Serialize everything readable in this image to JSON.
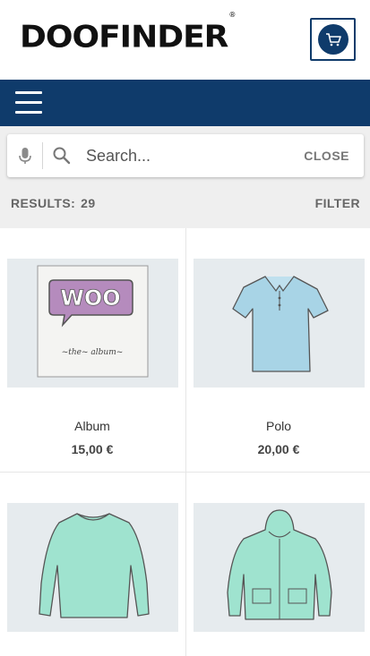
{
  "header": {
    "logo_text": "DOOFINDER",
    "logo_mark": "®",
    "cart_icon": "cart-icon",
    "accent": "#0f3b6b"
  },
  "navbar": {
    "menu_icon": "hamburger-icon"
  },
  "search": {
    "placeholder": "Search...",
    "value": "",
    "close_label": "CLOSE",
    "mic_icon": "microphone-icon",
    "search_icon": "search-icon"
  },
  "results": {
    "label": "RESULTS:",
    "count": "29",
    "filter_label": "FILTER"
  },
  "products": [
    {
      "name": "Album",
      "price": "15,00 €",
      "image": "woo-album-image"
    },
    {
      "name": "Polo",
      "price": "20,00 €",
      "image": "polo-shirt-image"
    },
    {
      "name": "",
      "price": "",
      "image": "long-sleeve-tee-image"
    },
    {
      "name": "",
      "price": "",
      "image": "hoodie-image"
    }
  ],
  "album_art": {
    "badge_text": "WOO",
    "caption": "~the~ album~"
  }
}
